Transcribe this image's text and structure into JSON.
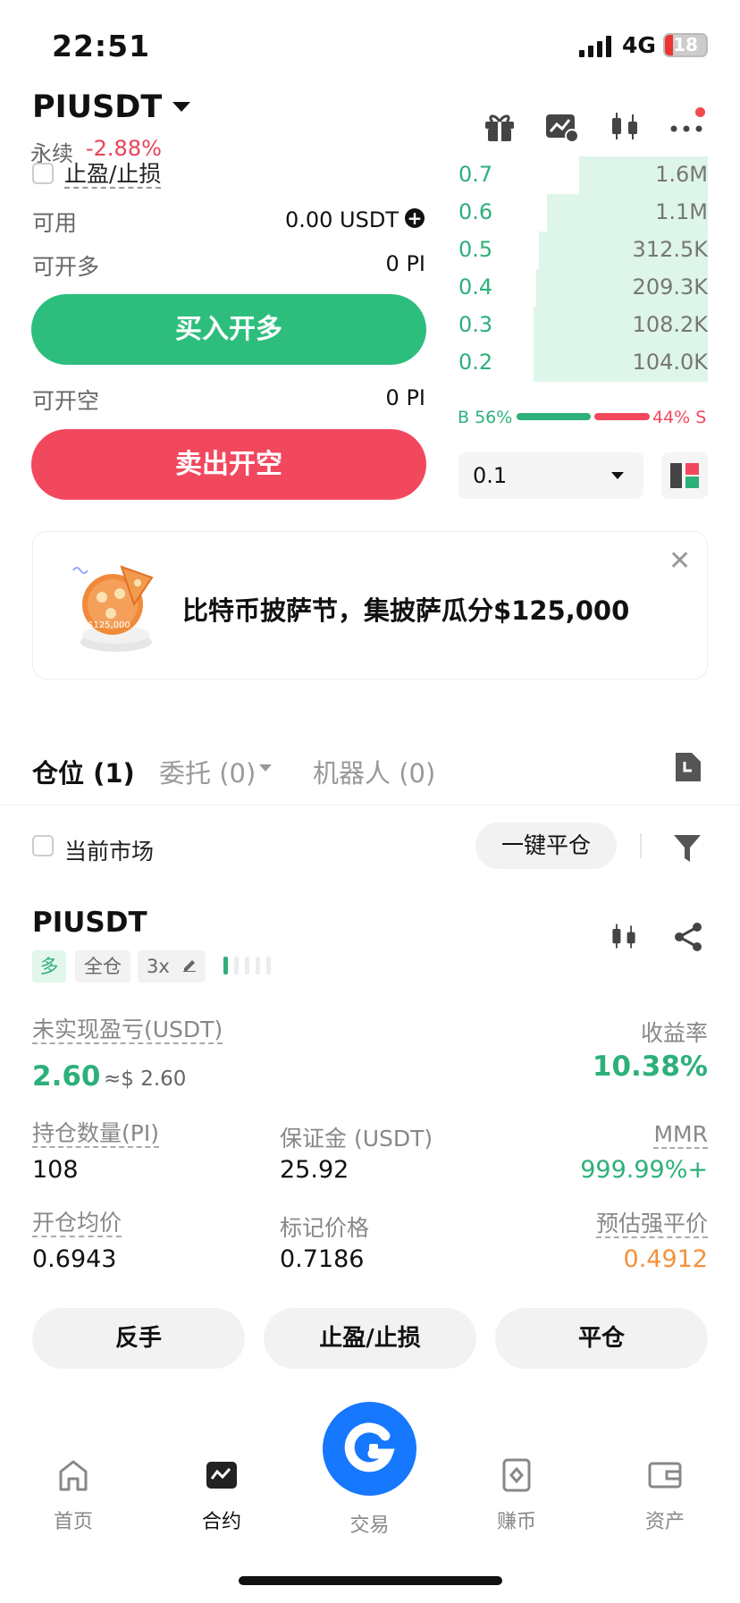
{
  "status_bar": {
    "time": "22:51",
    "network": "4G",
    "battery": "18"
  },
  "header": {
    "symbol": "PIUSDT",
    "contract_type": "永续",
    "change": "-2.88%"
  },
  "order_form": {
    "tpsl_label": "止盈/止损",
    "available_label": "可用",
    "available_value": "0.00 USDT",
    "can_long_label": "可开多",
    "can_long_value": "0 PI",
    "buy_button": "买入开多",
    "can_short_label": "可开空",
    "can_short_value": "0 PI",
    "sell_button": "卖出开空"
  },
  "orderbook": {
    "rows": [
      {
        "price": "0.7",
        "qty": "1.6M",
        "depth": 0.51
      },
      {
        "price": "0.6",
        "qty": "1.1M",
        "depth": 0.64
      },
      {
        "price": "0.5",
        "qty": "312.5K",
        "depth": 0.67
      },
      {
        "price": "0.4",
        "qty": "209.3K",
        "depth": 0.68
      },
      {
        "price": "0.3",
        "qty": "108.2K",
        "depth": 0.69
      },
      {
        "price": "0.2",
        "qty": "104.0K",
        "depth": 0.69
      }
    ],
    "buy_ratio": "B 56%",
    "sell_ratio": "44% S",
    "precision": "0.1"
  },
  "banner": {
    "text": "比特币披萨节，集披萨瓜分$125,000",
    "image_label": "$125,000"
  },
  "tabs": {
    "positions": "仓位 (1)",
    "orders": "委托 (0)",
    "bots": "机器人 (0)"
  },
  "filter": {
    "current_market": "当前市场",
    "close_all": "一键平仓"
  },
  "position": {
    "symbol": "PIUSDT",
    "side": "多",
    "margin_mode": "全仓",
    "leverage": "3x",
    "unrealized_pnl_label": "未实现盈亏(USDT)",
    "unrealized_pnl": "2.60",
    "unrealized_pnl_usd": "≈$ 2.60",
    "roe_label": "收益率",
    "roe": "10.38%",
    "size_label": "持仓数量(PI)",
    "size": "108",
    "margin_label": "保证金 (USDT)",
    "margin": "25.92",
    "mmr_label": "MMR",
    "mmr": "999.99%+",
    "entry_label": "开仓均价",
    "entry": "0.6943",
    "mark_label": "标记价格",
    "mark": "0.7186",
    "liq_label": "预估强平价",
    "liq": "0.4912",
    "reverse_button": "反手",
    "tpsl_button": "止盈/止损",
    "close_button": "平仓"
  },
  "nav": {
    "home": "首页",
    "futures": "合约",
    "trade": "交易",
    "earn": "赚币",
    "assets": "资产"
  },
  "colors": {
    "green": "#2db07a",
    "red": "#f2485e",
    "orange": "#f5913d",
    "blue": "#1677ff"
  }
}
